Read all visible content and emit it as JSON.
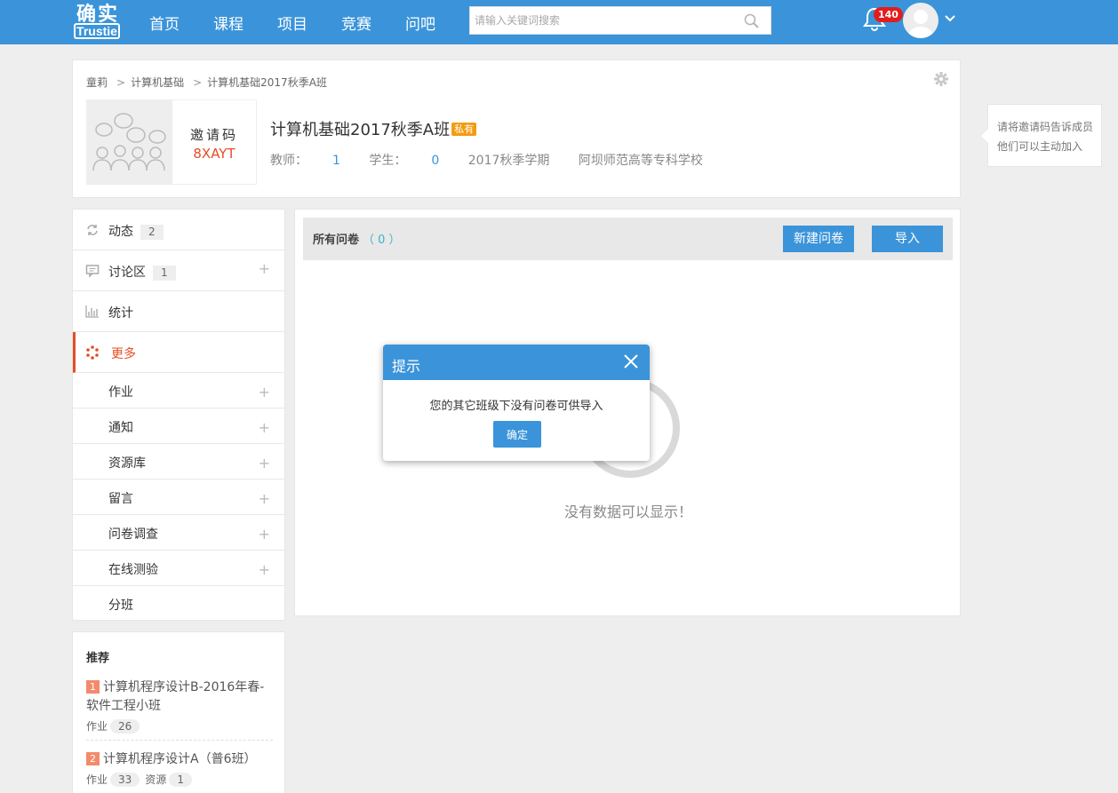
{
  "header": {
    "logo": {
      "top": "确实",
      "box": "Trustie"
    },
    "nav": [
      "首页",
      "课程",
      "项目",
      "竞赛",
      "问吧"
    ],
    "search_placeholder": "请输入关键词搜索",
    "notification_count": "140",
    "brand_color": "#3b94d9"
  },
  "course": {
    "breadcrumb": [
      "童莉",
      "计算机基础",
      "计算机基础2017秋季A班"
    ],
    "breadcrumb_sep": ">",
    "invite_label": "邀请码",
    "invite_code": "8XAYT",
    "title": "计算机基础2017秋季A班",
    "private_tag": "私有",
    "teacher_label": "教师：",
    "teacher_count": "1",
    "student_label": "学生：",
    "student_count": "0",
    "term": "2017秋季学期",
    "school": "阿坝师范高等专科学校"
  },
  "tip": {
    "line1": "请将邀请码告诉成员",
    "line2": "他们可以主动加入"
  },
  "sidebar": {
    "items": [
      {
        "label": "动态",
        "count": "2"
      },
      {
        "label": "讨论区",
        "count": "1"
      },
      {
        "label": "统计"
      },
      {
        "label": "更多"
      }
    ],
    "sub_items": [
      "作业",
      "通知",
      "资源库",
      "留言",
      "问卷调查",
      "在线测验",
      "分班"
    ],
    "plus": "+"
  },
  "recommend": {
    "title": "推荐",
    "items": [
      {
        "num": "1",
        "name": "计算机程序设计B-2016年春-软件工程小班",
        "meta": [
          {
            "label": "作业",
            "value": "26"
          }
        ]
      },
      {
        "num": "2",
        "name": "计算机程序设计A（普6班）",
        "meta": [
          {
            "label": "作业",
            "value": "33"
          },
          {
            "label": "资源",
            "value": "1"
          }
        ]
      }
    ]
  },
  "main": {
    "section_title": "所有问卷",
    "section_count": "（ 0 ）",
    "new_button": "新建问卷",
    "import_button": "导入",
    "empty_text": "没有数据可以显示！"
  },
  "dialog": {
    "title": "提示",
    "message": "您的其它班级下没有问卷可供导入",
    "ok": "确定"
  }
}
